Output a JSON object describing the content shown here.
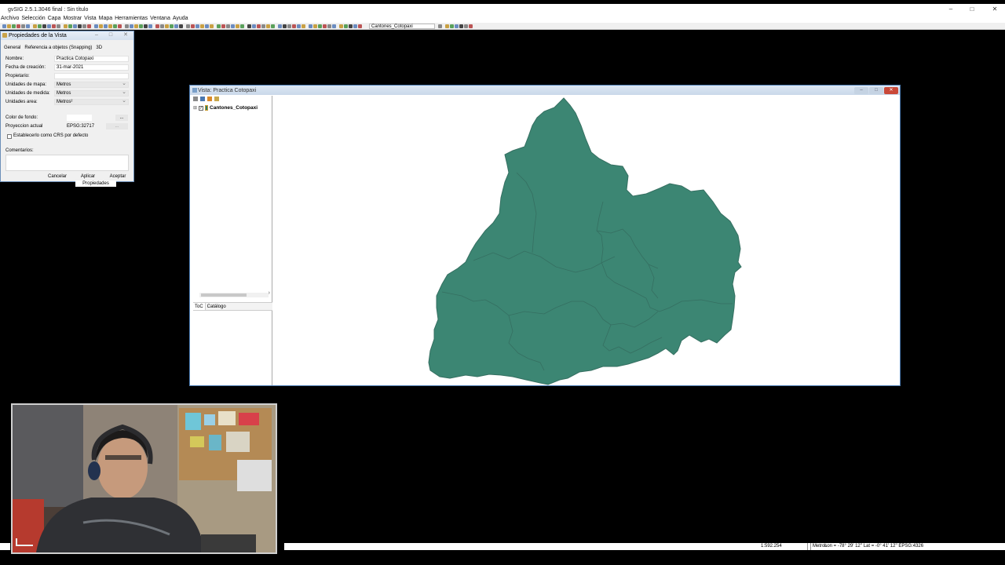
{
  "app": {
    "title": "gvSIG 2.5.1.3046 final : Sin título",
    "window_controls": [
      "–",
      "□",
      "✕"
    ]
  },
  "menu": [
    "Archivo",
    "Selección",
    "Capa",
    "Mostrar",
    "Vista",
    "Mapa",
    "Herramientas",
    "Ventana",
    "Ayuda"
  ],
  "toolbar": {
    "layer_selector_value": "Cantones_Cotopaxi"
  },
  "properties_dialog": {
    "title": "Propiedades de la Vista",
    "tabs": [
      "General",
      "Referencia a objetos (Snapping)",
      "3D"
    ],
    "fields": {
      "nombre_label": "Nombre:",
      "nombre_value": "Practica Cotopaxi",
      "fecha_label": "Fecha de creación:",
      "fecha_value": "31-mar-2021",
      "propietario_label": "Propietario:",
      "propietario_value": "",
      "unidades_mapa_label": "Unidades de mapa:",
      "unidades_mapa_value": "Metros",
      "unidades_medida_label": "Unidades de medida:",
      "unidades_medida_value": "Metros",
      "unidades_area_label": "Unidades area:",
      "unidades_area_value": "Metros²",
      "color_fondo_label": "Color de fondo:",
      "color_button": "...",
      "proyeccion_label": "Proyeccion actual",
      "proyeccion_value": "EPSG:32717",
      "proyeccion_button": "...",
      "default_crs_label": "Establecerlo como CRS por defecto",
      "comentarios_label": "Comentarios:"
    },
    "buttons": {
      "cancel": "Cancelar",
      "apply": "Aplicar",
      "accept": "Aceptar"
    },
    "tooltip": "Propiedades"
  },
  "view_window": {
    "title": "Vista: Practica Cotopaxi",
    "toc": {
      "layer_name": "Cantones_Cotopaxi",
      "layer_checked": true,
      "tabs": [
        "ToC",
        "Catálogo"
      ]
    },
    "map_fill_color": "#3c8673",
    "map_stroke_color": "#356f61"
  },
  "status_bar": {
    "scale": "1:592.254",
    "units": "Metros",
    "coords": "Lon = -78° 29' 12''  Lat = -0° 41' 12''  EPSG:4326"
  }
}
